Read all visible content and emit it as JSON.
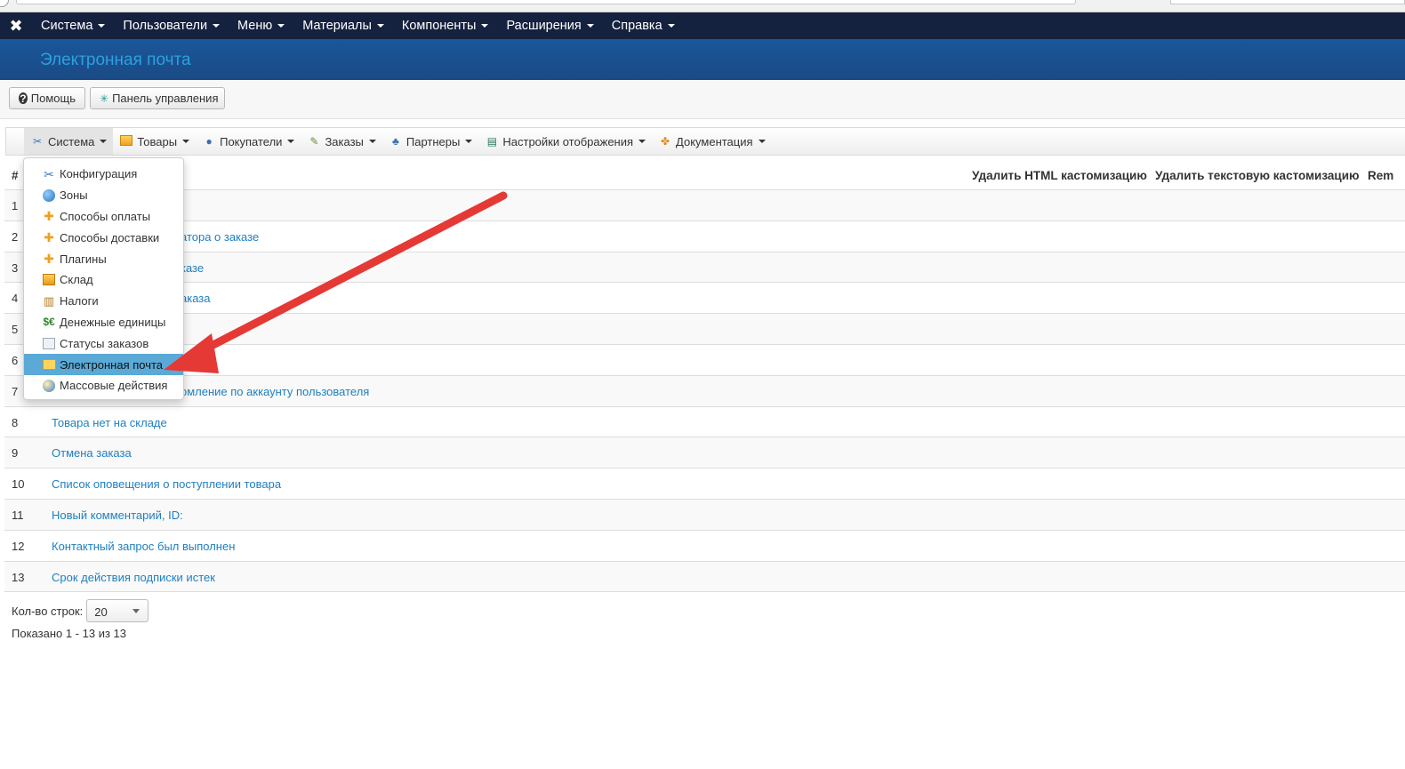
{
  "topnav": {
    "items": [
      {
        "label": "Система"
      },
      {
        "label": "Пользователи"
      },
      {
        "label": "Меню"
      },
      {
        "label": "Материалы"
      },
      {
        "label": "Компоненты"
      },
      {
        "label": "Расширения"
      },
      {
        "label": "Справка"
      }
    ]
  },
  "header": {
    "title": "Электронная почта"
  },
  "toolbar": {
    "help_label": "Помощь",
    "dashboard_label": "Панель управления"
  },
  "submenu": {
    "items": [
      {
        "label": "Система",
        "icon": "tools-icon"
      },
      {
        "label": "Товары",
        "icon": "folder-icon"
      },
      {
        "label": "Покупатели",
        "icon": "users-icon"
      },
      {
        "label": "Заказы",
        "icon": "orders-icon"
      },
      {
        "label": "Партнеры",
        "icon": "partners-icon"
      },
      {
        "label": "Настройки отображения",
        "icon": "display-settings-icon"
      },
      {
        "label": "Документация",
        "icon": "documentation-icon"
      }
    ]
  },
  "dropdown": {
    "items": [
      {
        "label": "Конфигурация",
        "icon": "tools-icon"
      },
      {
        "label": "Зоны",
        "icon": "globe-icon"
      },
      {
        "label": "Способы оплаты",
        "icon": "puzzle-icon"
      },
      {
        "label": "Способы доставки",
        "icon": "puzzle-icon"
      },
      {
        "label": "Плагины",
        "icon": "puzzle-icon"
      },
      {
        "label": "Склад",
        "icon": "warehouse-icon"
      },
      {
        "label": "Налоги",
        "icon": "bank-icon"
      },
      {
        "label": "Денежные единицы",
        "icon": "currency-icon"
      },
      {
        "label": "Статусы заказов",
        "icon": "order-status-icon"
      },
      {
        "label": "Электронная почта",
        "icon": "mail-icon",
        "selected": true
      },
      {
        "label": "Массовые действия",
        "icon": "mass-actions-icon"
      }
    ]
  },
  "table": {
    "headers": {
      "num": "#",
      "delete_html": "Удалить HTML кастомизацию",
      "delete_text": "Удалить текстовую кастомизацию",
      "remove": "Rem"
    },
    "rows": [
      {
        "num": "1",
        "title": ""
      },
      {
        "num": "2",
        "title": "атора о заказе"
      },
      {
        "num": "3",
        "title": "казе"
      },
      {
        "num": "4",
        "title": "аказа"
      },
      {
        "num": "5",
        "title": ""
      },
      {
        "num": "6",
        "title": ""
      },
      {
        "num": "7",
        "title": "омление по аккаунту пользователя"
      },
      {
        "num": "8",
        "title": "Товара нет на складе"
      },
      {
        "num": "9",
        "title": "Отмена заказа"
      },
      {
        "num": "10",
        "title": "Список оповещения о поступлении товара"
      },
      {
        "num": "11",
        "title": "Новый комментарий, ID:"
      },
      {
        "num": "12",
        "title": "Контактный запрос был выполнен"
      },
      {
        "num": "13",
        "title": "Срок действия подписки истек"
      }
    ]
  },
  "footer": {
    "rows_label": "Кол-во строк:",
    "rows_value": "20",
    "shown_text": "Показано 1 - 13 из 13"
  },
  "colors": {
    "navbar": "#15223f",
    "header": "#1a4f8f",
    "title": "#2da0e0",
    "link": "#1f7fc0",
    "selected": "#5aa9d6",
    "arrow": "#e53935"
  }
}
